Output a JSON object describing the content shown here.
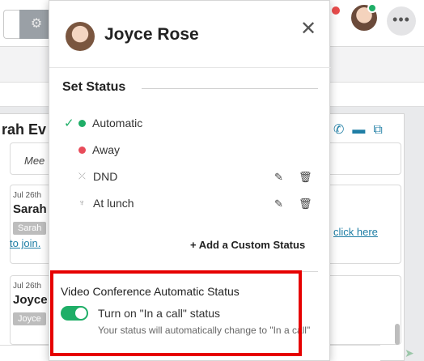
{
  "background": {
    "chat_name": "rah Ev",
    "meet_text": "Mee",
    "messages": [
      {
        "date": "Jul 26th",
        "name": "Sarah",
        "tag": "Sarah",
        "link_left": "to join.",
        "link_right": "click here"
      },
      {
        "date": "Jul 26th",
        "name": "Joyce",
        "tag": "Joyce"
      }
    ]
  },
  "popup": {
    "user_name": "Joyce Rose",
    "close_icon": "close-icon",
    "set_status_heading": "Set Status",
    "statuses": [
      {
        "label": "Automatic",
        "selected": true,
        "color": "#1fae67"
      },
      {
        "label": "Away",
        "color": "#e84c5a"
      },
      {
        "label": "DND",
        "editable": true
      },
      {
        "label": "At lunch",
        "editable": true
      }
    ],
    "add_custom_label": "+ Add a Custom Status",
    "video_conference": {
      "title": "Video Conference Automatic Status",
      "toggle_label": "Turn on \"In a call\" status",
      "toggle_on": true,
      "description": "Your status will automatically change to \"In a call\""
    }
  },
  "colors": {
    "accent_green": "#1fae67",
    "away_red": "#e84c5a",
    "highlight_red": "#e60000",
    "link_blue": "#1f7ea5"
  }
}
